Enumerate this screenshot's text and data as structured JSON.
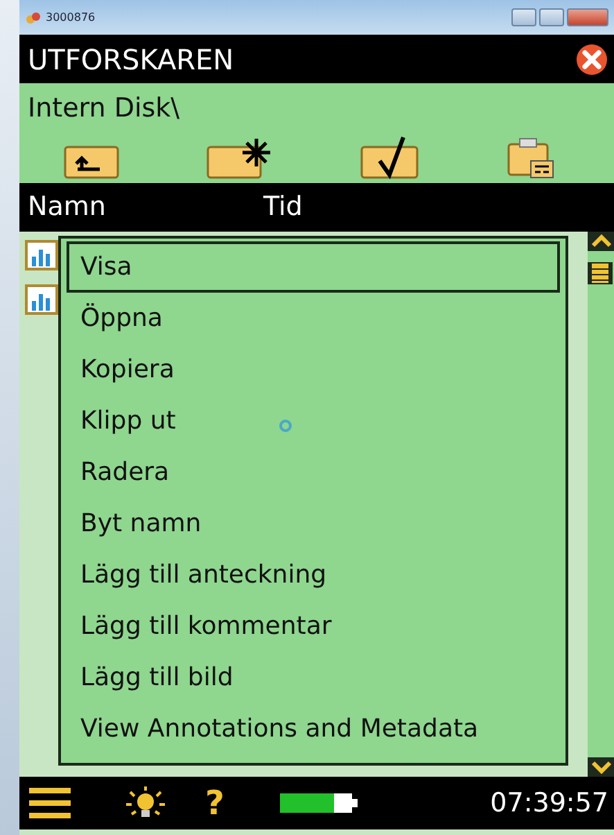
{
  "window": {
    "title": "3000876"
  },
  "header": {
    "title": "UTFORSKAREN"
  },
  "path": "Intern Disk\\",
  "columns": [
    "Namn",
    "Tid"
  ],
  "file_rows": [
    {
      "kind": "chart-file"
    },
    {
      "kind": "chart-file"
    }
  ],
  "context_menu": [
    {
      "label": "Visa",
      "selected": true
    },
    {
      "label": "Öppna",
      "selected": false
    },
    {
      "label": "Kopiera",
      "selected": false
    },
    {
      "label": "Klipp ut",
      "selected": false
    },
    {
      "label": "Radera",
      "selected": false
    },
    {
      "label": "Byt namn",
      "selected": false
    },
    {
      "label": "Lägg till anteckning",
      "selected": false
    },
    {
      "label": "Lägg till kommentar",
      "selected": false
    },
    {
      "label": "Lägg till bild",
      "selected": false
    },
    {
      "label": "View Annotations and Metadata",
      "selected": false
    }
  ],
  "status_bar": {
    "help": "?",
    "battery": {
      "level": 0.75
    },
    "time": "07:39:57"
  }
}
